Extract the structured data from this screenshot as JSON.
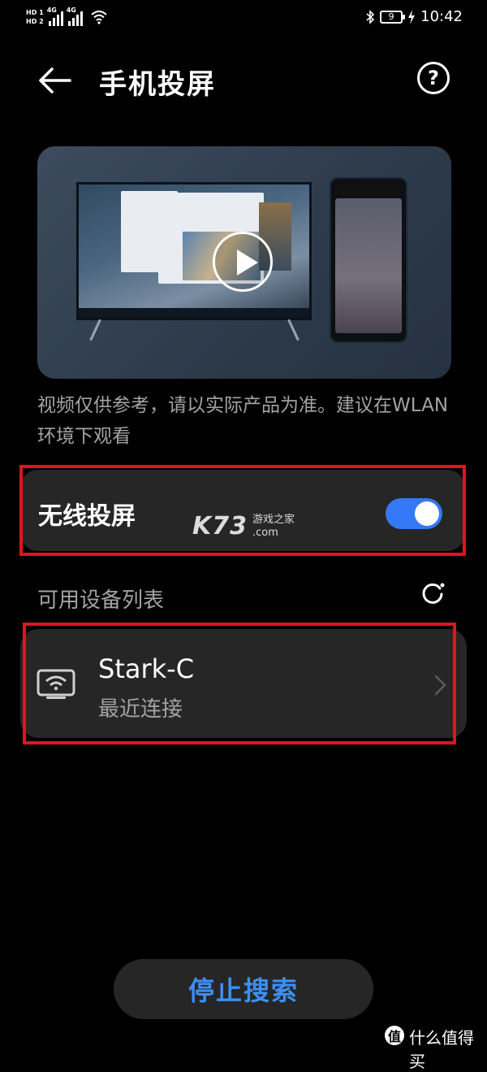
{
  "status_bar": {
    "hd1": "HD 1",
    "hd2": "HD 2",
    "net1": "4G",
    "net2": "4G",
    "battery": "9",
    "time": "10:42"
  },
  "header": {
    "title": "手机投屏",
    "help_glyph": "?"
  },
  "video": {
    "note": "视频仅供参考，请以实际产品为准。建议在WLAN 环境下观看"
  },
  "wireless": {
    "label": "无线投屏",
    "enabled": true
  },
  "watermark": {
    "logo": "K73",
    "line1": "游戏之家",
    "line2": ".com"
  },
  "devices": {
    "section_label": "可用设备列表",
    "items": [
      {
        "name": "Stark-C",
        "status": "最近连接"
      }
    ]
  },
  "footer": {
    "stop_label": "停止搜索"
  },
  "site": {
    "logo": "值",
    "text": "什么值得买"
  },
  "colors": {
    "accent": "#3478f6",
    "link": "#3d8ff5",
    "highlight": "#e0141e",
    "card": "#262626"
  }
}
